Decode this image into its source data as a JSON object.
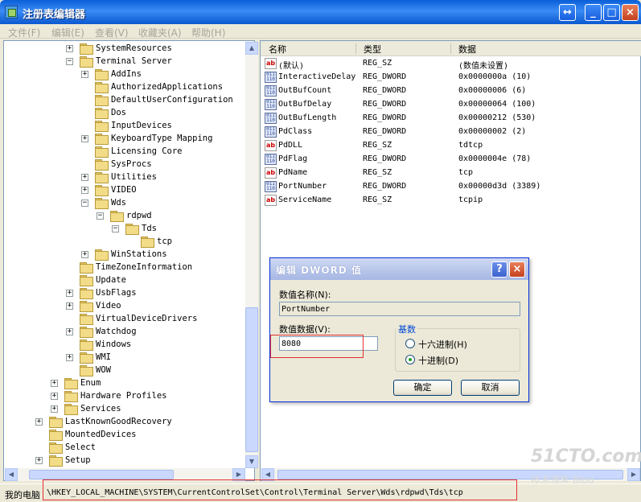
{
  "window": {
    "title": "注册表编辑器"
  },
  "menu": [
    "文件(F)",
    "编辑(E)",
    "查看(V)",
    "收藏夹(A)",
    "帮助(H)"
  ],
  "tree": [
    {
      "label": "SystemResources",
      "expander": "+"
    },
    {
      "label": "Terminal Server",
      "expander": "−"
    },
    {
      "label": "AddIns",
      "expander": "+"
    },
    {
      "label": "AuthorizedApplications",
      "expander": ""
    },
    {
      "label": "DefaultUserConfiguration",
      "expander": ""
    },
    {
      "label": "Dos",
      "expander": ""
    },
    {
      "label": "InputDevices",
      "expander": ""
    },
    {
      "label": "KeyboardType Mapping",
      "expander": "+"
    },
    {
      "label": "Licensing Core",
      "expander": ""
    },
    {
      "label": "SysProcs",
      "expander": ""
    },
    {
      "label": "Utilities",
      "expander": "+"
    },
    {
      "label": "VIDEO",
      "expander": "+"
    },
    {
      "label": "Wds",
      "expander": "−"
    },
    {
      "label": "rdpwd",
      "expander": "−"
    },
    {
      "label": "Tds",
      "expander": "−"
    },
    {
      "label": "tcp",
      "expander": ""
    },
    {
      "label": "WinStations",
      "expander": "+"
    },
    {
      "label": "TimeZoneInformation",
      "expander": ""
    },
    {
      "label": "Update",
      "expander": ""
    },
    {
      "label": "UsbFlags",
      "expander": "+"
    },
    {
      "label": "Video",
      "expander": "+"
    },
    {
      "label": "VirtualDeviceDrivers",
      "expander": ""
    },
    {
      "label": "Watchdog",
      "expander": "+"
    },
    {
      "label": "Windows",
      "expander": ""
    },
    {
      "label": "WMI",
      "expander": "+"
    },
    {
      "label": "WOW",
      "expander": ""
    },
    {
      "label": "Enum",
      "expander": "+"
    },
    {
      "label": "Hardware Profiles",
      "expander": "+"
    },
    {
      "label": "Services",
      "expander": "+"
    },
    {
      "label": "LastKnownGoodRecovery",
      "expander": "+"
    },
    {
      "label": "MountedDevices",
      "expander": ""
    },
    {
      "label": "Select",
      "expander": ""
    },
    {
      "label": "Setup",
      "expander": "+"
    }
  ],
  "list": {
    "headers": [
      "名称",
      "类型",
      "数据"
    ],
    "rows": [
      {
        "icon": "string-value-icon",
        "name": "(默认)",
        "type": "REG_SZ",
        "data": "(数值未设置)"
      },
      {
        "icon": "binary-value-icon",
        "name": "InteractiveDelay",
        "type": "REG_DWORD",
        "data": "0x0000000a (10)"
      },
      {
        "icon": "binary-value-icon",
        "name": "OutBufCount",
        "type": "REG_DWORD",
        "data": "0x00000006 (6)"
      },
      {
        "icon": "binary-value-icon",
        "name": "OutBufDelay",
        "type": "REG_DWORD",
        "data": "0x00000064 (100)"
      },
      {
        "icon": "binary-value-icon",
        "name": "OutBufLength",
        "type": "REG_DWORD",
        "data": "0x00000212 (530)"
      },
      {
        "icon": "binary-value-icon",
        "name": "PdClass",
        "type": "REG_DWORD",
        "data": "0x00000002 (2)"
      },
      {
        "icon": "string-value-icon",
        "name": "PdDLL",
        "type": "REG_SZ",
        "data": "tdtcp"
      },
      {
        "icon": "binary-value-icon",
        "name": "PdFlag",
        "type": "REG_DWORD",
        "data": "0x0000004e (78)"
      },
      {
        "icon": "string-value-icon",
        "name": "PdName",
        "type": "REG_SZ",
        "data": "tcp"
      },
      {
        "icon": "binary-value-icon",
        "name": "PortNumber",
        "type": "REG_DWORD",
        "data": "0x00000d3d (3389)"
      },
      {
        "icon": "string-value-icon",
        "name": "ServiceName",
        "type": "REG_SZ",
        "data": "tcpip"
      }
    ]
  },
  "dialog": {
    "title": "编辑 DWORD 值",
    "name_label": "数值名称(N):",
    "name_value": "PortNumber",
    "data_label": "数值数据(V):",
    "data_value": "8080",
    "base_label": "基数",
    "hex_label": "十六进制(H)",
    "dec_label": "十进制(D)",
    "selected_base": "dec",
    "ok": "确定",
    "cancel": "取消"
  },
  "status": {
    "computer": "我的电脑",
    "path": "\\HKEY_LOCAL_MACHINE\\SYSTEM\\CurrentControlSet\\Control\\Terminal Server\\Wds\\rdpwd\\Tds\\tcp"
  },
  "watermark": {
    "line1": "51CTO.com",
    "line2": "技术博客 Blog"
  },
  "colors": {
    "title_blue": "#0a5fd8",
    "highlight_red": "#e23030",
    "group_blue": "#0046d5"
  }
}
